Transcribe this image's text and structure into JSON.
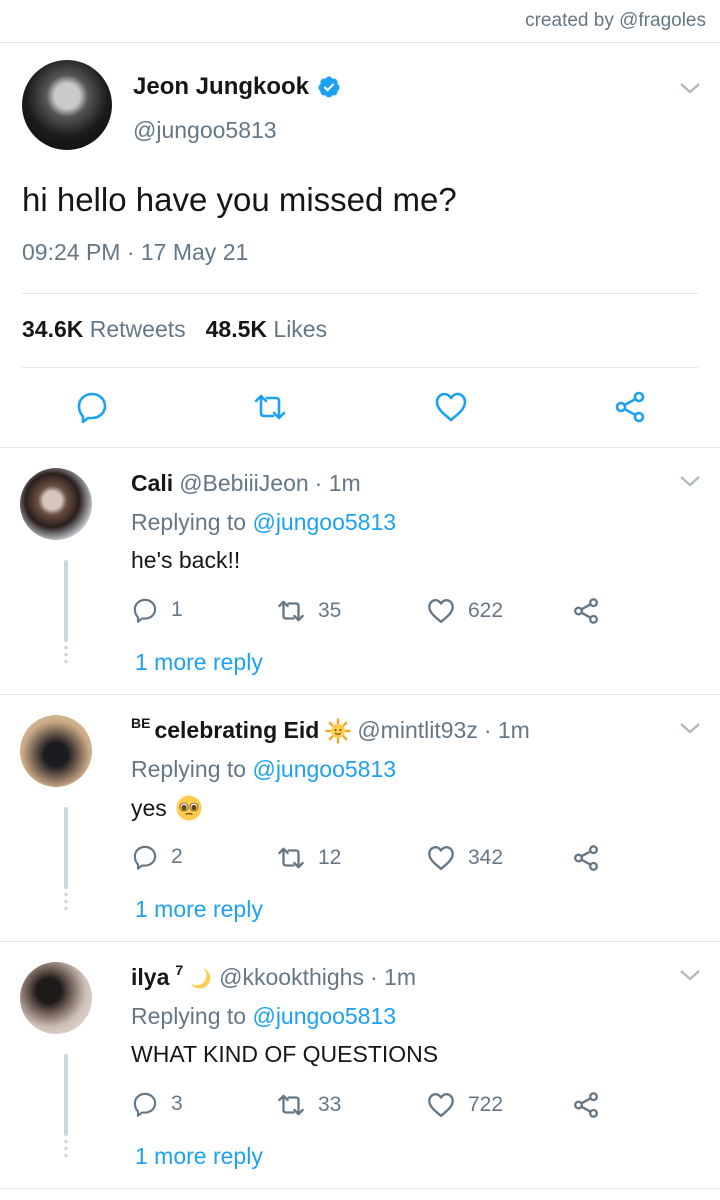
{
  "credit": "created by @fragoles",
  "main_tweet": {
    "name": "Jeon Jungkook",
    "handle": "@jungoo5813",
    "text": "hi hello have you missed me?",
    "timestamp": "09:24 PM · 17 May 21",
    "retweets_count": "34.6K",
    "retweets_label": "Retweets",
    "likes_count": "48.5K",
    "likes_label": "Likes",
    "icons": [
      "reply-icon",
      "retweet-icon",
      "like-icon",
      "share-icon"
    ]
  },
  "replies": [
    {
      "name": "Cali",
      "badge": "",
      "handle": "@BebiiiJeon",
      "time": "· 1m",
      "replying_prefix": "Replying to",
      "replying_to": "@jungoo5813",
      "text": "he's back!!",
      "reply_count": "1",
      "retweet_count": "35",
      "like_count": "622",
      "more_label": "1 more reply"
    },
    {
      "name": "celebrating Eid",
      "badge": "BE",
      "handle": "@mintlit93z",
      "time": "· 1m",
      "replying_prefix": "Replying to",
      "replying_to": "@jungoo5813",
      "text": "yes",
      "reply_count": "2",
      "retweet_count": "12",
      "like_count": "342",
      "more_label": "1 more reply"
    },
    {
      "name": "ilya",
      "badge": "7",
      "handle": "@kkookthighs",
      "time": "· 1m",
      "replying_prefix": "Replying to",
      "replying_to": "@jungoo5813",
      "text": "WHAT KIND OF QUESTIONS",
      "reply_count": "3",
      "retweet_count": "33",
      "like_count": "722",
      "more_label": "1 more reply"
    }
  ],
  "colors": {
    "accent": "#1da1f2",
    "text": "#14171a",
    "secondary": "#657786",
    "divider": "#e1e8ed"
  }
}
